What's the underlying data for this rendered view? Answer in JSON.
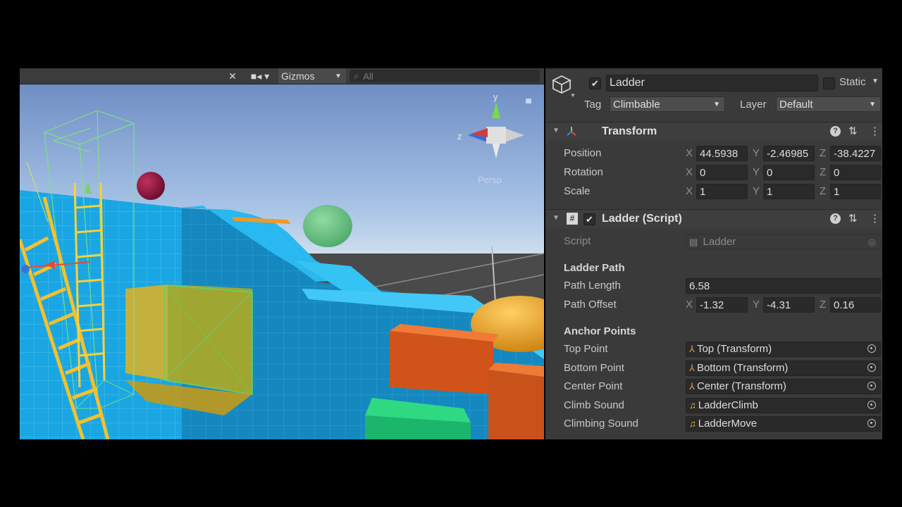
{
  "scene": {
    "gizmos_label": "Gizmos",
    "search_placeholder": "All",
    "axis_y": "y",
    "axis_z": "z",
    "persp_label": "Persp"
  },
  "object": {
    "name": "Ladder",
    "active": true,
    "static_label": "Static",
    "tag_label": "Tag",
    "tag_value": "Climbable",
    "layer_label": "Layer",
    "layer_value": "Default"
  },
  "transform": {
    "title": "Transform",
    "position_label": "Position",
    "rotation_label": "Rotation",
    "scale_label": "Scale",
    "position": {
      "x": "44.5938",
      "y": "-2.46985",
      "z": "-38.4227"
    },
    "rotation": {
      "x": "0",
      "y": "0",
      "z": "0"
    },
    "scale": {
      "x": "1",
      "y": "1",
      "z": "1"
    },
    "axis_x": "X",
    "axis_y": "Y",
    "axis_z": "Z"
  },
  "script": {
    "title": "Ladder (Script)",
    "script_label": "Script",
    "script_value": "Ladder",
    "ladder_path_header": "Ladder Path",
    "path_length_label": "Path Length",
    "path_length_value": "6.58",
    "path_offset_label": "Path Offset",
    "path_offset": {
      "x": "-1.32",
      "y": "-4.31",
      "z": "0.16"
    },
    "anchor_header": "Anchor Points",
    "fields": [
      {
        "label": "Top Point",
        "value": "Top (Transform)",
        "icon": "transform-icon"
      },
      {
        "label": "Bottom Point",
        "value": "Bottom (Transform)",
        "icon": "transform-icon"
      },
      {
        "label": "Center Point",
        "value": "Center (Transform)",
        "icon": "transform-icon"
      },
      {
        "label": "Climb Sound",
        "value": "LadderClimb",
        "icon": "audio-icon"
      },
      {
        "label": "Climbing Sound",
        "value": "LadderMove",
        "icon": "audio-icon"
      }
    ]
  },
  "colors": {
    "inspector_bg": "#3a3a3a",
    "field_bg": "#2a2a2a",
    "sky_top": "#6f8ec4",
    "floor": "#4a4a4a",
    "cyan_wall": "#19a3e0",
    "ladder": "#f2c12e"
  }
}
